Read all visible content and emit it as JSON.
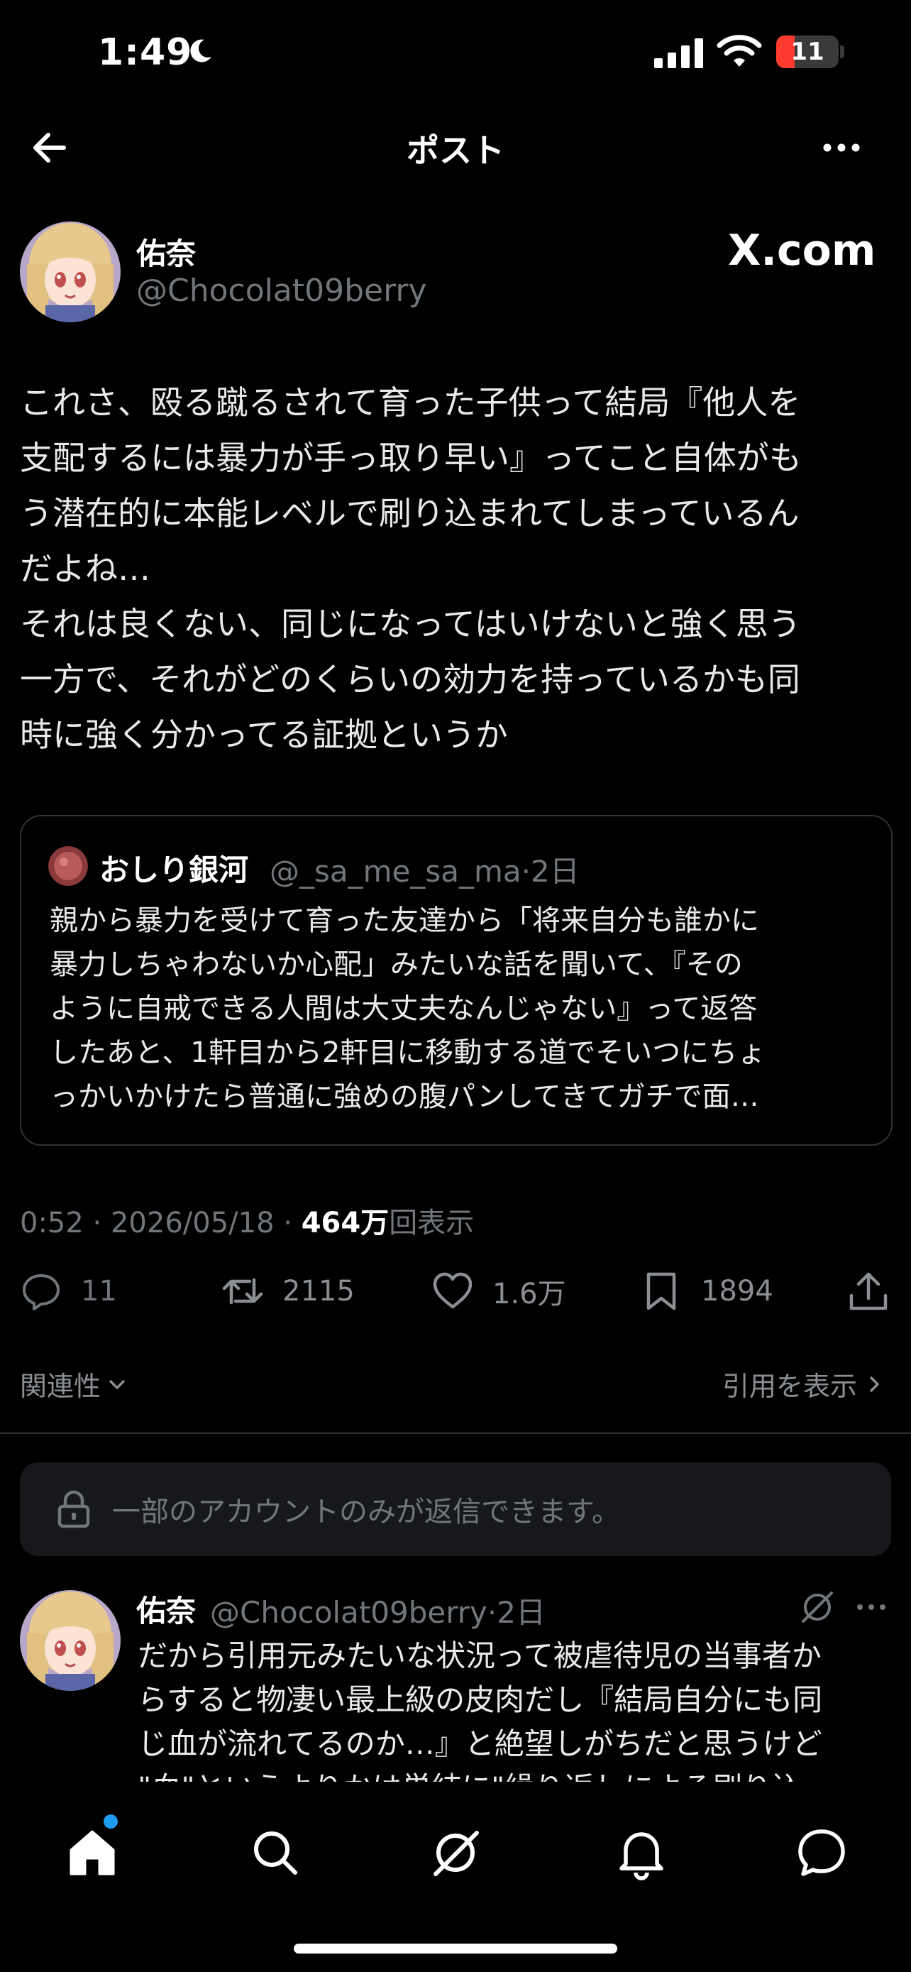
{
  "status_bar": {
    "time": "1:49",
    "battery": "11",
    "battery_level": 0.11
  },
  "header": {
    "title": "ポスト"
  },
  "post": {
    "author_name": "佑奈",
    "author_handle": "@Chocolat09berry",
    "source_logo": "X.com",
    "text": "これさ、殴る蹴るされて育った子供って結局『他人を\n支配するには暴力が手っ取り早い』ってこと自体がも\nう潜在的に本能レベルで刷り込まれてしまっているん\nだよね…\nそれは良くない、同じになってはいけないと強く思う\n一方で、それがどのくらいの効力を持っているかも同\n時に強く分かってる証拠というか",
    "time": "0:52",
    "date": "2026/05/18",
    "views_count": "464万",
    "views_label": "回表示"
  },
  "quote": {
    "author_name": "おしり銀河",
    "author_handle": "@_sa_me_sa_ma",
    "age": "2日",
    "text": "親から暴力を受けて育った友達から「将来自分も誰かに\n暴力しちゃわないか心配」みたいな話を聞いて、『その\nように自戒できる人間は大丈夫なんじゃない』って返答\nしたあと、1軒目から2軒目に移動する道でそいつにちょ\nっかいかけたら普通に強めの腹パンしてきてガチで面…"
  },
  "actions": {
    "replies": "11",
    "reposts": "2115",
    "likes": "1.6万",
    "bookmarks": "1894"
  },
  "sort": {
    "label": "関連性"
  },
  "quotes_link": {
    "label": "引用を表示"
  },
  "reply_restriction": {
    "text": "一部のアカウントのみが返信できます。"
  },
  "reply": {
    "author_name": "佑奈",
    "author_handle": "@Chocolat09berry",
    "age": "2日",
    "text": "だから引用元みたいな状況って被虐待児の当事者か\nらすると物凄い最上級の皮肉だし『結局自分にも同\nじ血が流れてるのか…』と絶望しがちだと思うけど\n\"血\"というよりかは単純に\"繰り返しによる刷り込"
  },
  "tabbar": {
    "items": [
      "home-icon",
      "search-icon",
      "grok-icon",
      "bell-icon",
      "messages-icon"
    ]
  },
  "colors": {
    "accent": "#1d9bf0",
    "muted": "#71767b",
    "text": "#e7e9ea",
    "battery_low": "#ff3b30"
  }
}
